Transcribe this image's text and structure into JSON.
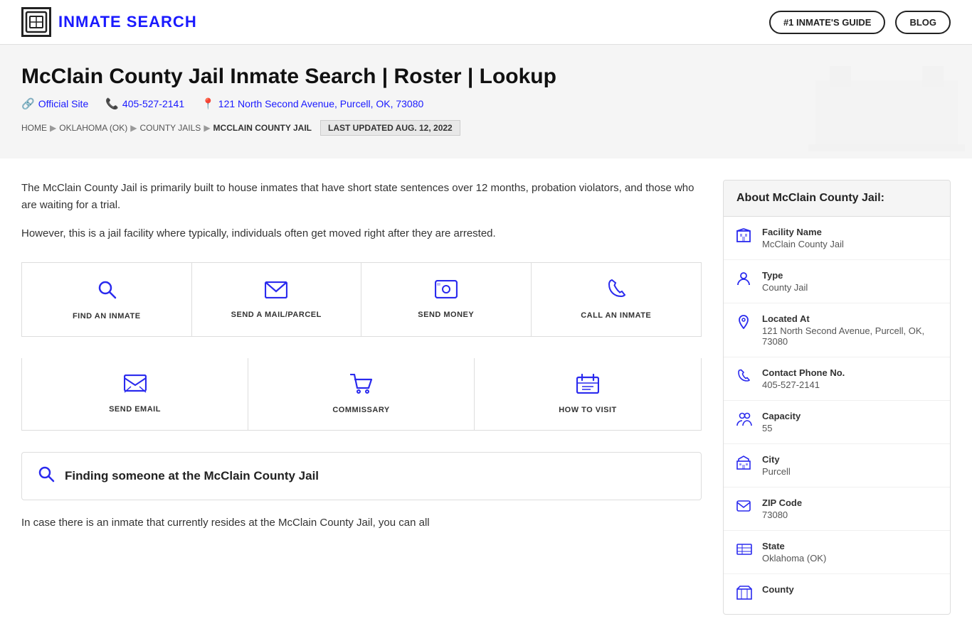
{
  "header": {
    "logo_text": "INMATE SEARCH",
    "nav_btn1": "#1 INMATE'S GUIDE",
    "nav_btn2": "BLOG"
  },
  "hero": {
    "title": "McClain County Jail Inmate Search | Roster | Lookup",
    "official_site": "Official Site",
    "phone": "405-527-2141",
    "address": "121 North Second Avenue, Purcell, OK, 73080",
    "breadcrumb": {
      "home": "HOME",
      "state": "OKLAHOMA (OK)",
      "jails": "COUNTY JAILS",
      "current": "MCCLAIN COUNTY JAIL"
    },
    "last_updated": "LAST UPDATED AUG. 12, 2022"
  },
  "description": {
    "p1": "The McClain County Jail is primarily built to house inmates that have short state sentences over 12 months, probation violators, and those who are waiting for a trial.",
    "p2": "However, this is a jail facility where typically, individuals often get moved right after they are arrested."
  },
  "actions": {
    "row1": [
      {
        "label": "FIND AN INMATE",
        "icon": "🔍"
      },
      {
        "label": "SEND A MAIL/PARCEL",
        "icon": "✉"
      },
      {
        "label": "SEND MONEY",
        "icon": "📷"
      },
      {
        "label": "CALL AN INMATE",
        "icon": "📞"
      }
    ],
    "row2": [
      {
        "label": "SEND EMAIL",
        "icon": "💬"
      },
      {
        "label": "COMMISSARY",
        "icon": "🛒"
      },
      {
        "label": "HOW TO VISIT",
        "icon": "📋"
      }
    ]
  },
  "finding": {
    "icon": "🔍",
    "title": "Finding someone at the McClain County Jail"
  },
  "bottom_text": "In case there is an inmate that currently resides at the McClain County Jail, you can all",
  "sidebar": {
    "header": "About McClain County Jail:",
    "items": [
      {
        "icon": "🏢",
        "label": "Facility Name",
        "value": "McClain County Jail"
      },
      {
        "icon": "👤",
        "label": "Type",
        "value": "County Jail"
      },
      {
        "icon": "📍",
        "label": "Located At",
        "value": "121 North Second Avenue, Purcell, OK, 73080"
      },
      {
        "icon": "📞",
        "label": "Contact Phone No.",
        "value": "405-527-2141"
      },
      {
        "icon": "👥",
        "label": "Capacity",
        "value": "55"
      },
      {
        "icon": "🏙",
        "label": "City",
        "value": "Purcell"
      },
      {
        "icon": "✉",
        "label": "ZIP Code",
        "value": "73080"
      },
      {
        "icon": "🗺",
        "label": "State",
        "value": "Oklahoma (OK)"
      },
      {
        "icon": "🏛",
        "label": "County",
        "value": ""
      }
    ]
  }
}
